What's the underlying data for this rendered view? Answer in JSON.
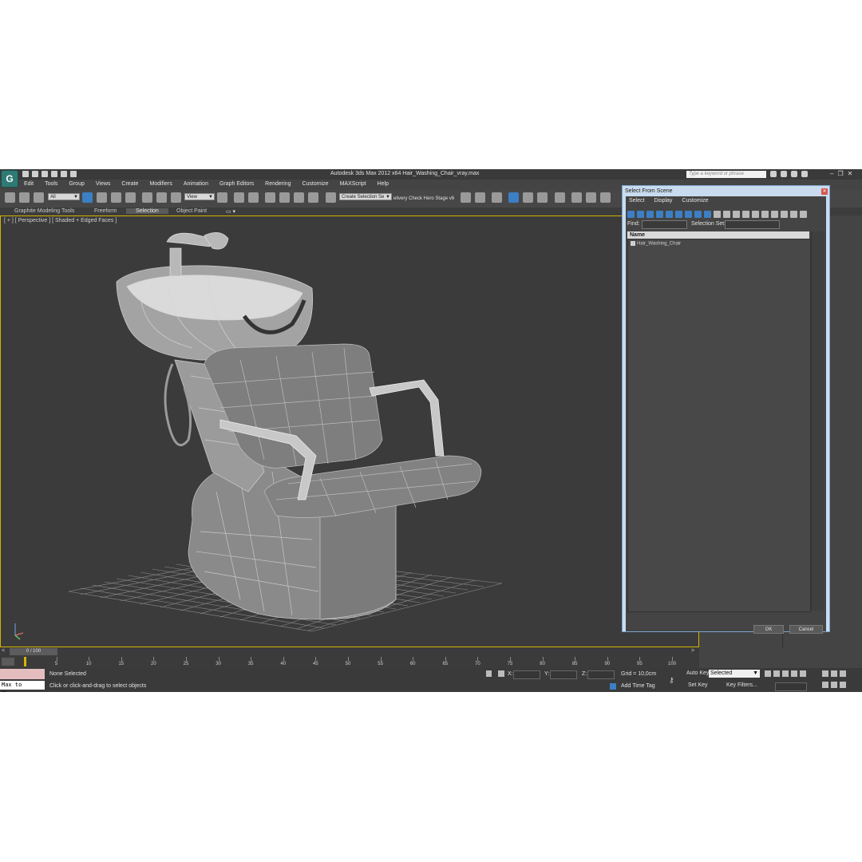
{
  "titlebar": {
    "app_title": "Autodesk 3ds Max  2012 x64      Hair_Washing_Chair_vray.max",
    "search_placeholder": "Type a keyword or phrase",
    "logo_text": "G"
  },
  "menubar": [
    "Edit",
    "Tools",
    "Group",
    "Views",
    "Create",
    "Modifiers",
    "Animation",
    "Graph Editors",
    "Rendering",
    "Customize",
    "MAXScript",
    "Help"
  ],
  "toolbar": {
    "selection_filter": "All",
    "ref_coord": "View",
    "selection_set": "Create Selection Se",
    "extra_text": "elivery Check  Hero Stage v6"
  },
  "ribbon_tabs": [
    "Graphite Modeling Tools",
    "Freeform",
    "Selection",
    "Object Paint"
  ],
  "viewport": {
    "label": "[ + ] [ Perspective ] [ Shaded + Edged Faces ]"
  },
  "dialog": {
    "title": "Select From Scene",
    "menu": [
      "Select",
      "Display",
      "Customize"
    ],
    "find_label": "Find:",
    "selection_set_label": "Selection Set:",
    "column_header": "Name",
    "items": [
      "Hair_Washing_Chair"
    ],
    "ok_label": "OK",
    "cancel_label": "Cancel"
  },
  "timeline": {
    "slider_label": "0 / 100",
    "ticks": [
      5,
      10,
      15,
      20,
      25,
      30,
      35,
      40,
      45,
      50,
      55,
      60,
      65,
      70,
      75,
      80,
      85,
      90,
      95,
      100
    ]
  },
  "status": {
    "max_to_physc": "Max to Physc.",
    "selection_status": "None Selected",
    "prompt": "Click or click-and-drag to select objects",
    "x_label": "X:",
    "y_label": "Y:",
    "z_label": "Z:",
    "grid": "Grid = 10,0cm",
    "add_time_tag": "Add Time Tag",
    "auto_key": "Auto Key",
    "set_key": "Set Key",
    "key_mode": "Selected",
    "key_filters": "Key Filters..."
  },
  "colors": {
    "viewport_border": "#d5b400",
    "accent_blue": "#3c7fc4",
    "dialog_frame": "#c9dcef"
  }
}
